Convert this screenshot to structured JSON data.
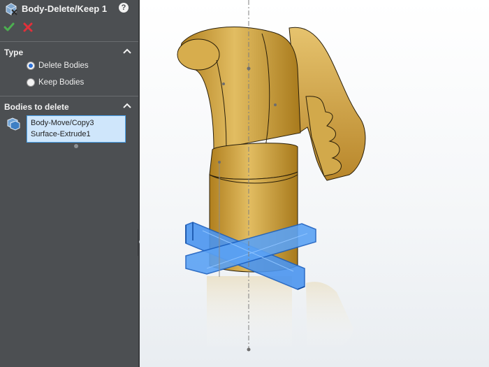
{
  "header": {
    "title": "Body-Delete/Keep 1",
    "help_label": "?"
  },
  "actions": {
    "ok": "check-icon",
    "cancel": "close-icon"
  },
  "type_section": {
    "title": "Type",
    "options": [
      {
        "label": "Delete Bodies",
        "selected": true
      },
      {
        "label": "Keep Bodies",
        "selected": false
      }
    ]
  },
  "bodies_section": {
    "title": "Bodies to delete",
    "items": [
      "Body-Move/Copy3",
      "Surface-Extrude1"
    ]
  },
  "colors": {
    "panel_bg": "#4c4f52",
    "accept": "#4caf50",
    "cancel": "#e0303a",
    "selection_box": "#cfe6fb",
    "model_gold": "#c99a2e",
    "highlight_blue": "#3d8bf2"
  }
}
